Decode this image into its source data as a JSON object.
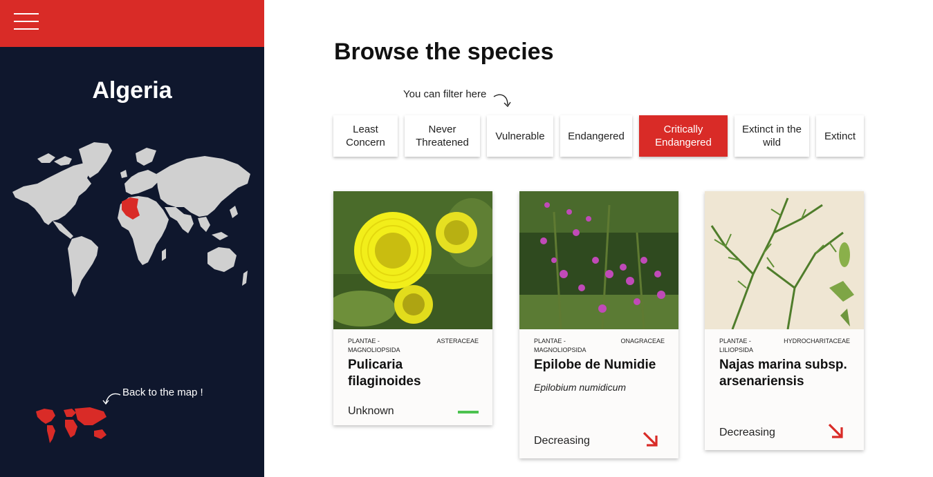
{
  "sidebar": {
    "country": "Algeria",
    "back_label": "Back to the map !",
    "colors": {
      "background": "#0f172d",
      "accent": "#d92b27",
      "land": "#d0d0d0"
    }
  },
  "main": {
    "title": "Browse the species",
    "filter_hint": "You can filter here",
    "filters": [
      {
        "label": "Least Concern",
        "active": false
      },
      {
        "label": "Never Threatened",
        "active": false
      },
      {
        "label": "Vulnerable",
        "active": false
      },
      {
        "label": "Endangered",
        "active": false
      },
      {
        "label": "Critically Endangered",
        "active": true
      },
      {
        "label": "Extinct in the wild",
        "active": false
      },
      {
        "label": "Extinct",
        "active": false
      }
    ],
    "cards": [
      {
        "kingdom_class": "PLANTAE - MAGNOLIOPSIDA",
        "family": "ASTERACEAE",
        "name": "Pulicaria filaginoides",
        "scientific": "",
        "trend": "Unknown",
        "trend_icon": "flat-line-icon"
      },
      {
        "kingdom_class": "PLANTAE - MAGNOLIOPSIDA",
        "family": "ONAGRACEAE",
        "name": "Epilobe de Numidie",
        "scientific": "Epilobium numidicum",
        "trend": "Decreasing",
        "trend_icon": "down-right-arrow-icon"
      },
      {
        "kingdom_class": "PLANTAE - LILIOPSIDA",
        "family": "HYDROCHARITACEAE",
        "name": "Najas marina subsp. arsenariensis",
        "scientific": "",
        "trend": "Decreasing",
        "trend_icon": "down-right-arrow-icon"
      }
    ]
  }
}
